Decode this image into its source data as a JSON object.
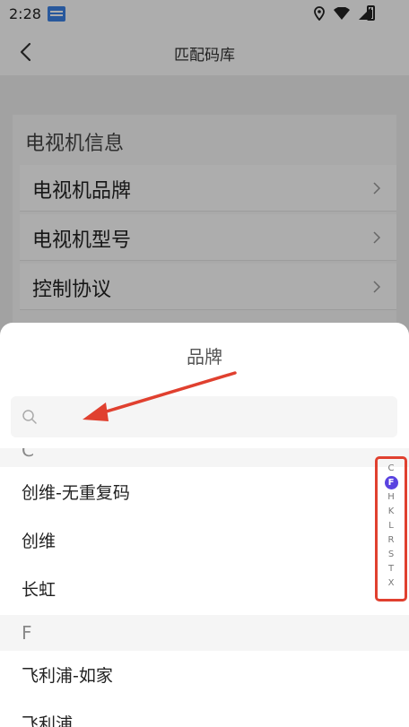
{
  "status_bar": {
    "time": "2:28"
  },
  "header": {
    "title": "匹配码库"
  },
  "info_card": {
    "title": "电视机信息",
    "rows": [
      {
        "label": "电视机品牌"
      },
      {
        "label": "电视机型号"
      },
      {
        "label": "控制协议"
      }
    ]
  },
  "sheet": {
    "title": "品牌",
    "search": {
      "value": "",
      "placeholder": ""
    },
    "sections": [
      {
        "letter": "C",
        "items": [
          "创维-无重复码",
          "创维",
          "长虹"
        ]
      },
      {
        "letter": "F",
        "items": [
          "飞利浦-如家",
          "飞利浦"
        ]
      }
    ],
    "index": [
      "C",
      "F",
      "H",
      "K",
      "L",
      "R",
      "S",
      "T",
      "X"
    ],
    "index_active": "F"
  },
  "colors": {
    "annotation": "#e0402f",
    "index_active": "#5a43e0"
  }
}
